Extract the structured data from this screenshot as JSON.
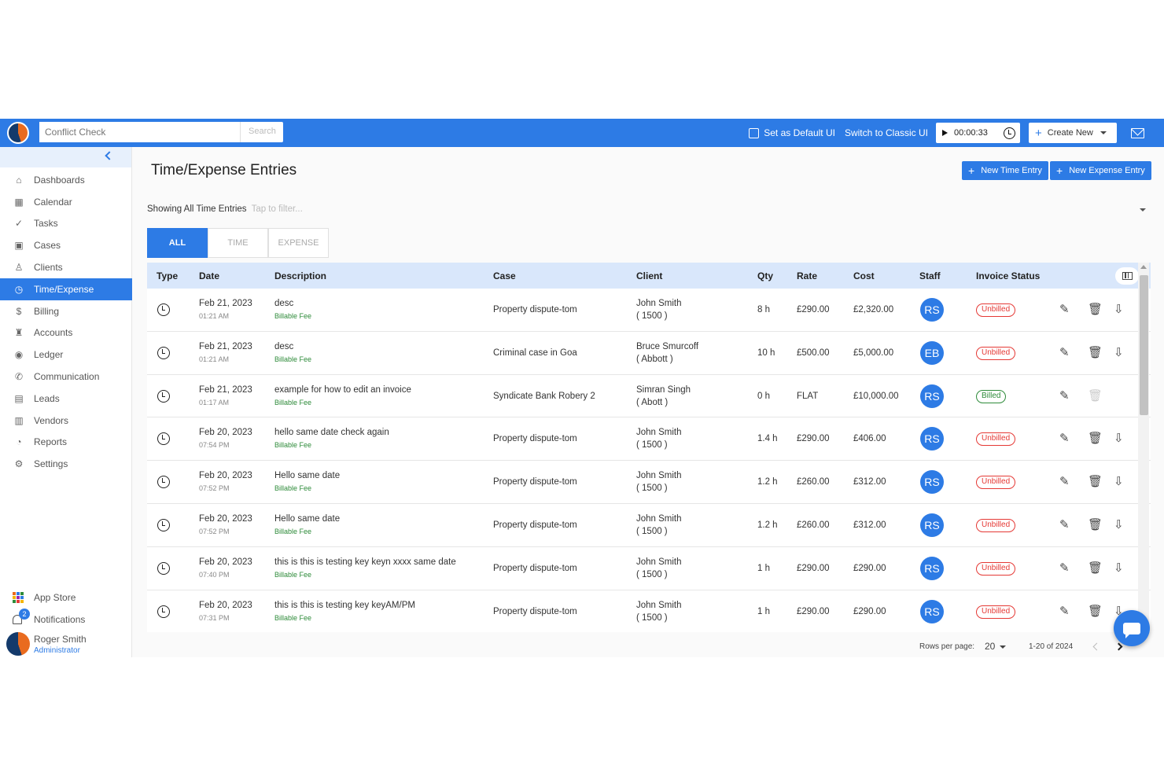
{
  "topbar": {
    "search_placeholder": "Conflict Check",
    "search_button": "Search",
    "set_default": "Set as Default UI",
    "switch_classic": "Switch to Classic UI",
    "timer": "00:00:33",
    "create_new": "Create New"
  },
  "sidebar": {
    "items": [
      {
        "label": "Dashboards",
        "icon": "home-icon",
        "glyph": "⌂"
      },
      {
        "label": "Calendar",
        "icon": "calendar-icon",
        "glyph": "▦"
      },
      {
        "label": "Tasks",
        "icon": "check-circle-icon",
        "glyph": "✓"
      },
      {
        "label": "Cases",
        "icon": "briefcase-icon",
        "glyph": "▣"
      },
      {
        "label": "Clients",
        "icon": "person-icon",
        "glyph": "♙"
      },
      {
        "label": "Time/Expense",
        "icon": "clock-icon",
        "glyph": "◷",
        "active": true
      },
      {
        "label": "Billing",
        "icon": "dollar-icon",
        "glyph": "$"
      },
      {
        "label": "Accounts",
        "icon": "bank-icon",
        "glyph": "♜"
      },
      {
        "label": "Ledger",
        "icon": "ledger-icon",
        "glyph": "◉"
      },
      {
        "label": "Communication",
        "icon": "phone-icon",
        "glyph": "✆"
      },
      {
        "label": "Leads",
        "icon": "leads-icon",
        "glyph": "▤"
      },
      {
        "label": "Vendors",
        "icon": "vendors-icon",
        "glyph": "▥"
      },
      {
        "label": "Reports",
        "icon": "chart-icon",
        "glyph": "◔"
      },
      {
        "label": "Settings",
        "icon": "gear-icon",
        "glyph": "⚙"
      }
    ],
    "app_store": "App Store",
    "notifications": "Notifications",
    "notification_count": "2",
    "user_name": "Roger Smith",
    "user_role": "Administrator"
  },
  "main": {
    "title": "Time/Expense Entries",
    "new_time_entry": "New Time Entry",
    "new_expense_entry": "New Expense Entry",
    "filter_label": "Showing All Time Entries",
    "filter_placeholder": "Tap to filter...",
    "tabs": [
      "ALL",
      "TIME",
      "EXPENSE"
    ]
  },
  "table": {
    "columns": [
      "Type",
      "Date",
      "Description",
      "Case",
      "Client",
      "Qty",
      "Rate",
      "Cost",
      "Staff",
      "Invoice Status"
    ],
    "rows": [
      {
        "date": "Feb 21, 2023",
        "time": "01:21 AM",
        "desc": "desc",
        "fee": "Billable Fee",
        "case": "Property dispute-tom",
        "client": "John Smith",
        "client_sub": "( 1500 )",
        "qty": "8 h",
        "rate": "£290.00",
        "cost": "£2,320.00",
        "staff": "RS",
        "status": "Unbilled",
        "download": true
      },
      {
        "date": "Feb 21, 2023",
        "time": "01:21 AM",
        "desc": "desc",
        "fee": "Billable Fee",
        "case": "Criminal case in Goa",
        "client": "Bruce Smurcoff",
        "client_sub": "( Abbott )",
        "qty": "10 h",
        "rate": "£500.00",
        "cost": "£5,000.00",
        "staff": "EB",
        "status": "Unbilled",
        "download": true
      },
      {
        "date": "Feb 21, 2023",
        "time": "01:17 AM",
        "desc": "example for how to edit an invoice",
        "fee": "Billable Fee",
        "case": "Syndicate Bank Robery 2",
        "client": "Simran Singh",
        "client_sub": "( Abott )",
        "qty": "0 h",
        "rate": "FLAT",
        "cost": "£10,000.00",
        "staff": "RS",
        "status": "Billed",
        "download": false
      },
      {
        "date": "Feb 20, 2023",
        "time": "07:54 PM",
        "desc": "hello same date check again",
        "fee": "Billable Fee",
        "case": "Property dispute-tom",
        "client": "John Smith",
        "client_sub": "( 1500 )",
        "qty": "1.4 h",
        "rate": "£290.00",
        "cost": "£406.00",
        "staff": "RS",
        "status": "Unbilled",
        "download": true
      },
      {
        "date": "Feb 20, 2023",
        "time": "07:52 PM",
        "desc": "Hello same date",
        "fee": "Billable Fee",
        "case": "Property dispute-tom",
        "client": "John Smith",
        "client_sub": "( 1500 )",
        "qty": "1.2 h",
        "rate": "£260.00",
        "cost": "£312.00",
        "staff": "RS",
        "status": "Unbilled",
        "download": true
      },
      {
        "date": "Feb 20, 2023",
        "time": "07:52 PM",
        "desc": "Hello same date",
        "fee": "Billable Fee",
        "case": "Property dispute-tom",
        "client": "John Smith",
        "client_sub": "( 1500 )",
        "qty": "1.2 h",
        "rate": "£260.00",
        "cost": "£312.00",
        "staff": "RS",
        "status": "Unbilled",
        "download": true
      },
      {
        "date": "Feb 20, 2023",
        "time": "07:40 PM",
        "desc": "this is this is testing key keyn xxxx same date",
        "fee": "Billable Fee",
        "case": "Property dispute-tom",
        "client": "John Smith",
        "client_sub": "( 1500 )",
        "qty": "1 h",
        "rate": "£290.00",
        "cost": "£290.00",
        "staff": "RS",
        "status": "Unbilled",
        "download": true
      },
      {
        "date": "Feb 20, 2023",
        "time": "07:31 PM",
        "desc": "this is this is testing key keyAM/PM",
        "fee": "Billable Fee",
        "case": "Property dispute-tom",
        "client": "John Smith",
        "client_sub": "( 1500 )",
        "qty": "1 h",
        "rate": "£290.00",
        "cost": "£290.00",
        "staff": "RS",
        "status": "Unbilled",
        "download": true
      }
    ]
  },
  "footer": {
    "rows_per_page_label": "Rows per page:",
    "rows_per_page": "20",
    "range": "1-20 of 2024"
  },
  "colors": {
    "accent": "#2d7be5",
    "unbilled": "#e53935",
    "billed": "#2e8b3a"
  }
}
